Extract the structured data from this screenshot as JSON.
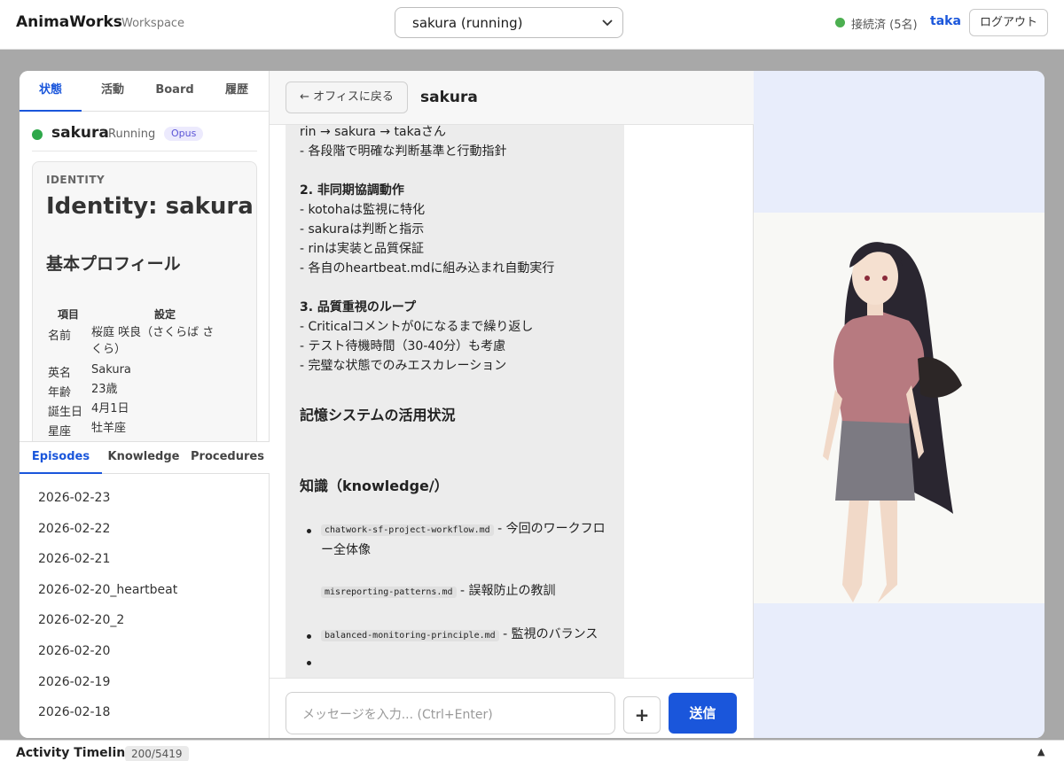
{
  "header": {
    "brand": "AnimaWorks",
    "brand_sub": "Workspace",
    "anima_select_value": "sakura (running)",
    "connection_status": "接続済 (5名)",
    "user": "taka",
    "logout_label": "ログアウト"
  },
  "left_tabs": [
    "状態",
    "活動",
    "Board",
    "履歴"
  ],
  "status": {
    "name": "sakura",
    "state": "Running",
    "model": "Opus",
    "dot_color": "#2ea84a"
  },
  "identity": {
    "label": "IDENTITY",
    "title": "Identity: sakura",
    "section_heading": "基本プロフィール",
    "table_headers": [
      "項目",
      "設定"
    ],
    "rows": [
      {
        "key": "名前",
        "value": "桜庭 咲良（さくらば さくら）"
      },
      {
        "key": "英名",
        "value": "Sakura"
      },
      {
        "key": "年齢",
        "value": "23歳"
      },
      {
        "key": "誕生日",
        "value": "4月1日"
      },
      {
        "key": "星座",
        "value": "牡羊座"
      }
    ]
  },
  "memory_tabs": [
    "Episodes",
    "Knowledge",
    "Procedures"
  ],
  "episodes": [
    "2026-02-23",
    "2026-02-22",
    "2026-02-21",
    "2026-02-20_heartbeat",
    "2026-02-20_2",
    "2026-02-20",
    "2026-02-19",
    "2026-02-18"
  ],
  "chat": {
    "back_label": "← オフィスに戻る",
    "title": "sakura",
    "lines": {
      "l1": "rin → sakura → takaさん",
      "l2": "- 各段階で明確な判断基準と行動指針",
      "h_async": "2. 非同期協調動作",
      "l3": "- kotohaは監視に特化",
      "l4": "- sakuraは判断と指示",
      "l5": "- rinは実装と品質保証",
      "l6": "- 各自のheartbeat.mdに組み込まれ自動実行",
      "h_quality": "3. 品質重視のループ",
      "l7": "- Criticalコメントが0になるまで繰り返し",
      "l8": "- テスト待機時間（30-40分）も考慮",
      "l9": "- 完璧な状態でのみエスカレーション",
      "h_memory": "記憶システムの活用状況",
      "h_knowledge": "知識（knowledge/）"
    },
    "bullets": [
      {
        "code": "chatwork-sf-project-workflow.md",
        "text": " - 今回のワークフロー全体像"
      },
      {
        "code": "misreporting-patterns.md",
        "text": " - 誤報防止の教訓"
      },
      {
        "code": "balanced-monitoring-principle.md",
        "text": " - 監視のバランス"
      }
    ],
    "input_placeholder": "メッセージを入力... (Ctrl+Enter)",
    "plus_label": "+",
    "send_label": "送信"
  },
  "bottom": {
    "title": "Activity Timeline",
    "count": "200/5419",
    "toggle": "▲"
  }
}
